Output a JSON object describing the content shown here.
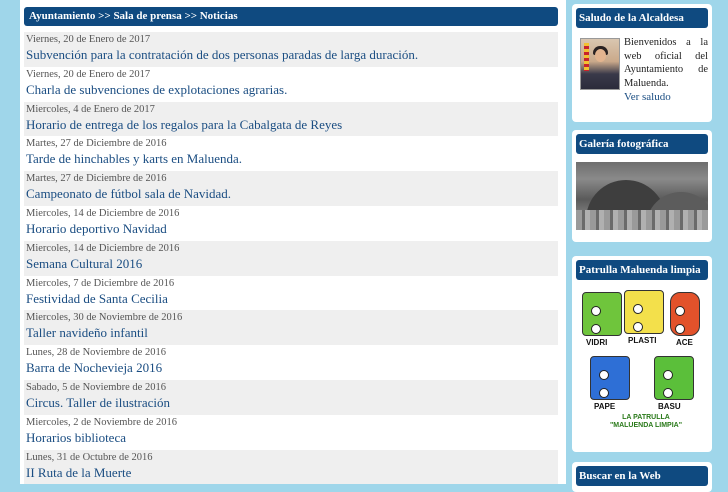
{
  "breadcrumb": "Ayuntamiento >> Sala de prensa >> Noticias",
  "news": [
    {
      "date": "Viernes, 20 de Enero de 2017",
      "title": "Subvención para la contratación de dos personas paradas de larga duración."
    },
    {
      "date": "Viernes, 20 de Enero de 2017",
      "title": "Charla de subvenciones de explotaciones agrarias."
    },
    {
      "date": "Miercoles, 4 de Enero de 2017",
      "title": "Horario de entrega de los regalos para la Cabalgata de Reyes"
    },
    {
      "date": "Martes, 27 de Diciembre de 2016",
      "title": "Tarde de hinchables y karts en Maluenda."
    },
    {
      "date": "Martes, 27 de Diciembre de 2016",
      "title": "Campeonato de fútbol sala de Navidad."
    },
    {
      "date": "Miercoles, 14 de Diciembre de 2016",
      "title": "Horario deportivo Navidad"
    },
    {
      "date": "Miercoles, 14 de Diciembre de 2016",
      "title": "Semana Cultural 2016"
    },
    {
      "date": "Miercoles, 7 de Diciembre de 2016",
      "title": "Festividad de Santa Cecilia"
    },
    {
      "date": "Miercoles, 30 de Noviembre de 2016",
      "title": "Taller navideño infantil"
    },
    {
      "date": "Lunes, 28 de Noviembre de 2016",
      "title": "Barra de Nochevieja 2016"
    },
    {
      "date": "Sabado, 5 de Noviembre de 2016",
      "title": "Circus. Taller de ilustración"
    },
    {
      "date": "Miercoles, 2 de Noviembre de 2016",
      "title": "Horarios biblioteca"
    },
    {
      "date": "Lunes, 31 de Octubre de 2016",
      "title": "II Ruta de la Muerte"
    }
  ],
  "saludo": {
    "header": "Saludo de la Alcaldesa",
    "text": "Bienvenidos a la web oficial del Ayuntamiento de Maluenda.",
    "link": "Ver saludo"
  },
  "galeria": {
    "header": "Galería fotográfica"
  },
  "patrulla": {
    "header": "Patrulla Maluenda limpia",
    "bins": [
      "VIDRI",
      "PLASTI",
      "ACE",
      "PAPE",
      "BASU"
    ],
    "caption_line1": "LA PATRULLA",
    "caption_line2": "\"MALUENDA LIMPIA\""
  },
  "buscar": {
    "header": "Buscar en la Web"
  },
  "colors": {
    "header_bg": "#0f4a80",
    "page_bg": "#9fd6ea",
    "link": "#1a4d82"
  }
}
